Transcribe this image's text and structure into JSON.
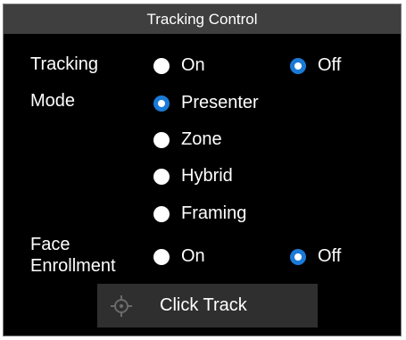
{
  "panel": {
    "title": "Tracking Control"
  },
  "tracking": {
    "label": "Tracking",
    "options": [
      {
        "label": "On",
        "selected": false
      },
      {
        "label": "Off",
        "selected": true
      }
    ]
  },
  "mode": {
    "label": "Mode",
    "options": [
      {
        "label": "Presenter",
        "selected": true
      },
      {
        "label": "Zone",
        "selected": false
      },
      {
        "label": "Hybrid",
        "selected": false
      },
      {
        "label": "Framing",
        "selected": false
      }
    ]
  },
  "face_enrollment": {
    "label_line1": "Face",
    "label_line2": "Enrollment",
    "options": [
      {
        "label": "On",
        "selected": false
      },
      {
        "label": "Off",
        "selected": true
      }
    ]
  },
  "click_track": {
    "label": "Click Track",
    "icon": "target-crosshair-icon"
  },
  "colors": {
    "accent": "#1a7ad8",
    "background": "#000000",
    "titlebar": "#3f3f3f",
    "button": "#2f2f2f"
  }
}
